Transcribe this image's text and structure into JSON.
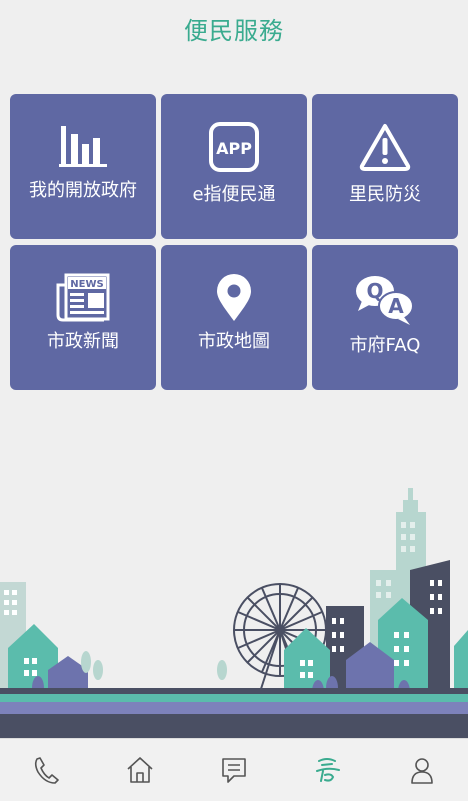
{
  "header": {
    "title": "便民服務"
  },
  "tiles": [
    {
      "label": "我的開放政府",
      "icon": "bar-chart-icon"
    },
    {
      "label": "e指便民通",
      "icon": "app-icon",
      "icon_text": "APP"
    },
    {
      "label": "里民防災",
      "icon": "warning-icon"
    },
    {
      "label": "市政新聞",
      "icon": "newspaper-icon",
      "icon_text": "NEWS"
    },
    {
      "label": "市政地圖",
      "icon": "map-pin-icon"
    },
    {
      "label": "市府FAQ",
      "icon": "qa-icon",
      "icon_text_q": "Q",
      "icon_text_a": "A"
    }
  ],
  "colors": {
    "accent": "#3aab8f",
    "tile": "#5f68a3",
    "nav_icon": "#555555"
  },
  "nav": [
    {
      "icon": "phone-icon"
    },
    {
      "icon": "home-icon"
    },
    {
      "icon": "message-icon"
    },
    {
      "icon": "service-icon",
      "active": true
    },
    {
      "icon": "user-icon"
    }
  ]
}
